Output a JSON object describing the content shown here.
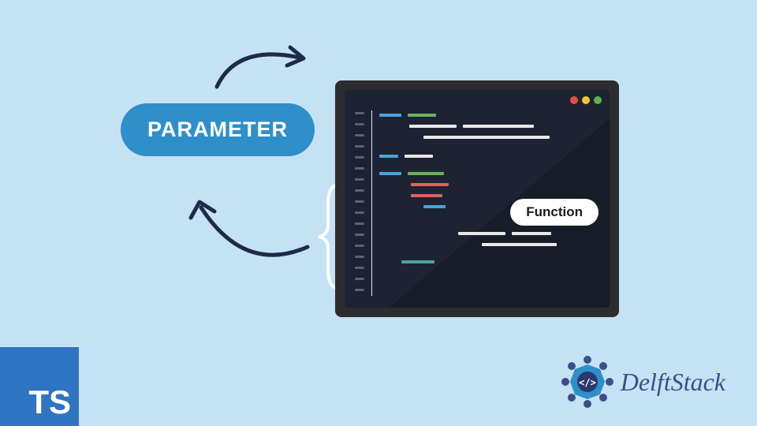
{
  "labels": {
    "parameter": "PARAMETER",
    "function": "Function"
  },
  "logos": {
    "ts": "TS",
    "delftstack": "DelftStack"
  },
  "icons": {
    "arrow_top": "curved-arrow-icon",
    "arrow_bottom": "curved-arrow-icon",
    "brace": "curly-brace-icon",
    "delft_emblem": "delftstack-emblem-icon"
  },
  "colors": {
    "background": "#c5e2f4",
    "parameter_bg": "#2f8fc9",
    "ts_bg": "#2f74c0",
    "arrow_stroke": "#1e2a4a",
    "monitor_frame": "#2d2c2f",
    "screen_bg": "#1d2333",
    "delft_text": "#3a4f8a"
  }
}
